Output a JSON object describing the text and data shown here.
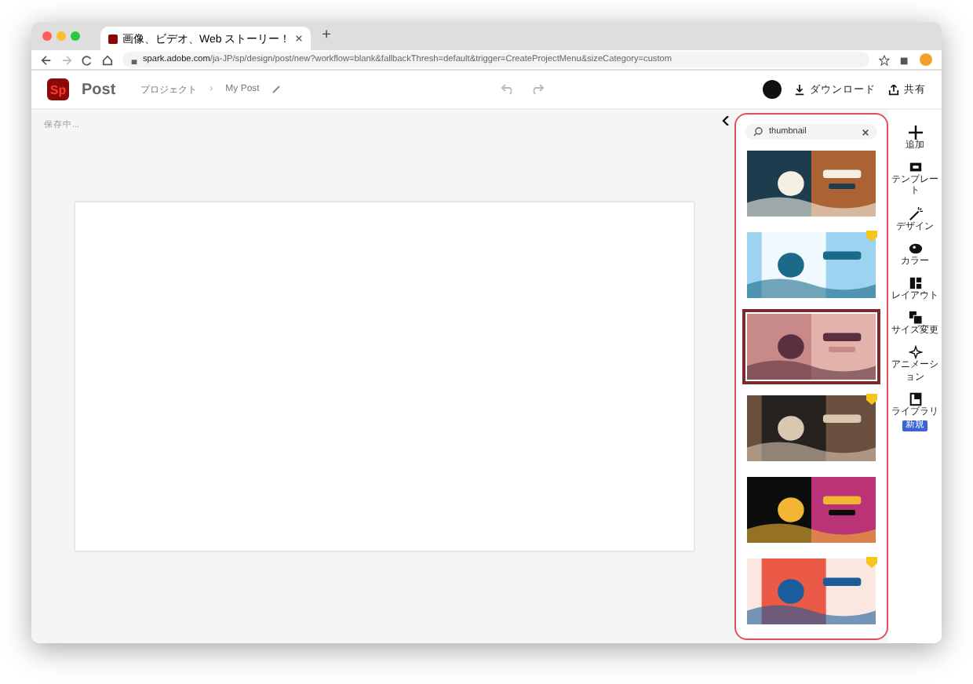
{
  "browser": {
    "tab_title": "画像、ビデオ、Web ストーリー！",
    "new_tab": "+",
    "url_host": "spark.adobe.com",
    "url_path": "/ja-JP/sp/design/post/new?workflow=blank&fallbackThresh=default&trigger=CreateProjectMenu&sizeCategory=custom"
  },
  "header": {
    "logo": "Sp",
    "app_name": "Post",
    "breadcrumb": [
      "プロジェクト",
      "My Post"
    ],
    "separator": "›",
    "download": "ダウンロード",
    "share": "共有"
  },
  "status": "保存中...",
  "search": {
    "value": "thumbnail"
  },
  "templates": [
    {
      "premium": false,
      "selected": false
    },
    {
      "premium": true,
      "selected": false
    },
    {
      "premium": false,
      "selected": true
    },
    {
      "premium": true,
      "selected": false
    },
    {
      "premium": false,
      "selected": false
    },
    {
      "premium": true,
      "selected": false
    }
  ],
  "rail": [
    {
      "kind": "plus",
      "label": "追加"
    },
    {
      "kind": "template",
      "label": "テンプレート"
    },
    {
      "kind": "design",
      "label": "デザイン"
    },
    {
      "kind": "color",
      "label": "カラー"
    },
    {
      "kind": "layout",
      "label": "レイアウト"
    },
    {
      "kind": "resize",
      "label": "サイズ変更"
    },
    {
      "kind": "animation",
      "label": "アニメーション"
    },
    {
      "kind": "library",
      "label": "ライブラリ",
      "badge": "新規"
    }
  ]
}
